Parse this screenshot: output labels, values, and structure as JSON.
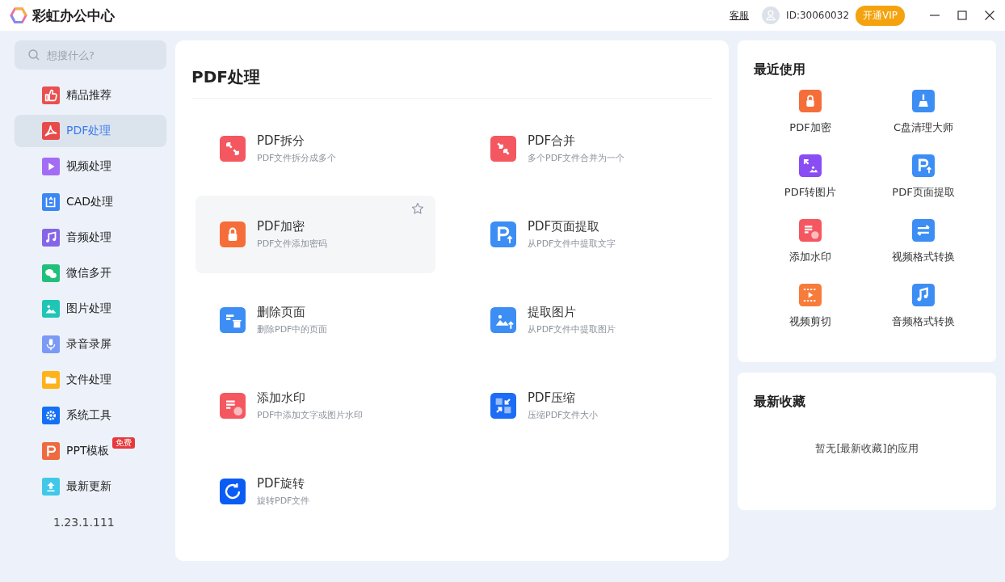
{
  "app": {
    "title": "彩虹办公中心"
  },
  "header": {
    "service_link": "客服",
    "user_id": "ID:30060032",
    "vip_button": "开通VIP"
  },
  "search": {
    "placeholder": "想搜什么?"
  },
  "sidebar": {
    "items": [
      {
        "label": "精品推荐",
        "selected": false,
        "color": "#e9504f"
      },
      {
        "label": "PDF处理",
        "selected": true,
        "color": "#e84a4a"
      },
      {
        "label": "视频处理",
        "selected": false,
        "color": "#a36cf5"
      },
      {
        "label": "CAD处理",
        "selected": false,
        "color": "#3b87f5"
      },
      {
        "label": "音频处理",
        "selected": false,
        "color": "#8465e8"
      },
      {
        "label": "微信多开",
        "selected": false,
        "color": "#20c07a"
      },
      {
        "label": "图片处理",
        "selected": false,
        "color": "#1fc6b5"
      },
      {
        "label": "录音录屏",
        "selected": false,
        "color": "#7a9af5"
      },
      {
        "label": "文件处理",
        "selected": false,
        "color": "#ffb31a"
      },
      {
        "label": "系统工具",
        "selected": false,
        "color": "#1570f5"
      },
      {
        "label": "PPT模板",
        "selected": false,
        "color": "#ef6a40",
        "badge": "免费"
      },
      {
        "label": "最新更新",
        "selected": false,
        "color": "#40c8e8"
      }
    ],
    "version": "1.23.1.111"
  },
  "main": {
    "title": "PDF处理",
    "tools": [
      {
        "name": "PDF拆分",
        "description": "PDF文件拆分成多个",
        "hovered": false,
        "color": "#f4575f"
      },
      {
        "name": "PDF合并",
        "description": "多个PDF文件合并为一个",
        "hovered": false,
        "color": "#f4575f"
      },
      {
        "name": "PDF加密",
        "description": "PDF文件添加密码",
        "hovered": true,
        "color": "#f56e3a"
      },
      {
        "name": "PDF页面提取",
        "description": "从PDF文件中提取文字",
        "hovered": false,
        "color": "#3c8ef5"
      },
      {
        "name": "删除页面",
        "description": "删除PDF中的页面",
        "hovered": false,
        "color": "#3c8ef5"
      },
      {
        "name": "提取图片",
        "description": "从PDF文件中提取图片",
        "hovered": false,
        "color": "#3c8ef5"
      },
      {
        "name": "添加水印",
        "description": "PDF中添加文字或图片水印",
        "hovered": false,
        "color": "#f4575f"
      },
      {
        "name": "PDF压缩",
        "description": "压缩PDF文件大小",
        "hovered": false,
        "color": "#1d6cf5"
      },
      {
        "name": "PDF旋转",
        "description": "旋转PDF文件",
        "hovered": false,
        "color": "#0a5cf5"
      }
    ]
  },
  "recent": {
    "title": "最近使用",
    "items": [
      {
        "label": "PDF加密",
        "color": "#f56e3a"
      },
      {
        "label": "C盘清理大师",
        "color": "#3c8ef5"
      },
      {
        "label": "PDF转图片",
        "color": "#8a4cf5"
      },
      {
        "label": "PDF页面提取",
        "color": "#3c8ef5"
      },
      {
        "label": "添加水印",
        "color": "#f4575f"
      },
      {
        "label": "视频格式转换",
        "color": "#3c8ef5"
      },
      {
        "label": "视频剪切",
        "color": "#f77b3a"
      },
      {
        "label": "音频格式转换",
        "color": "#3c8ef5"
      }
    ]
  },
  "favorites": {
    "title": "最新收藏",
    "empty_text": "暂无[最新收藏]的应用"
  }
}
